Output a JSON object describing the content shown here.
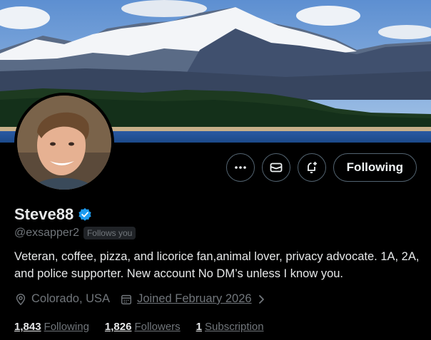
{
  "profile": {
    "display_name": "Steve88",
    "handle": "@exsapper2",
    "follows_you": "Follows you",
    "bio": "Veteran, coffee, pizza, and licorice fan,animal lover, privacy advocate. 1A, 2A, and police supporter. New account No DM’s unless I know you.",
    "location": "Colorado, USA",
    "joined": "Joined February 2026"
  },
  "actions": {
    "more_icon": "more-dots-icon",
    "message_icon": "envelope-icon",
    "notify_icon": "bell-plus-icon",
    "following_label": "Following"
  },
  "stats": {
    "following_count": "1,843",
    "following_label": "Following",
    "followers_count": "1,826",
    "followers_label": "Followers",
    "subscription_count": "1",
    "subscription_label": "Subscription"
  },
  "colors": {
    "background": "#000000",
    "text": "#e7e9ea",
    "muted": "#71767b",
    "verified_blue": "#1d9bf0",
    "border": "#536471"
  }
}
